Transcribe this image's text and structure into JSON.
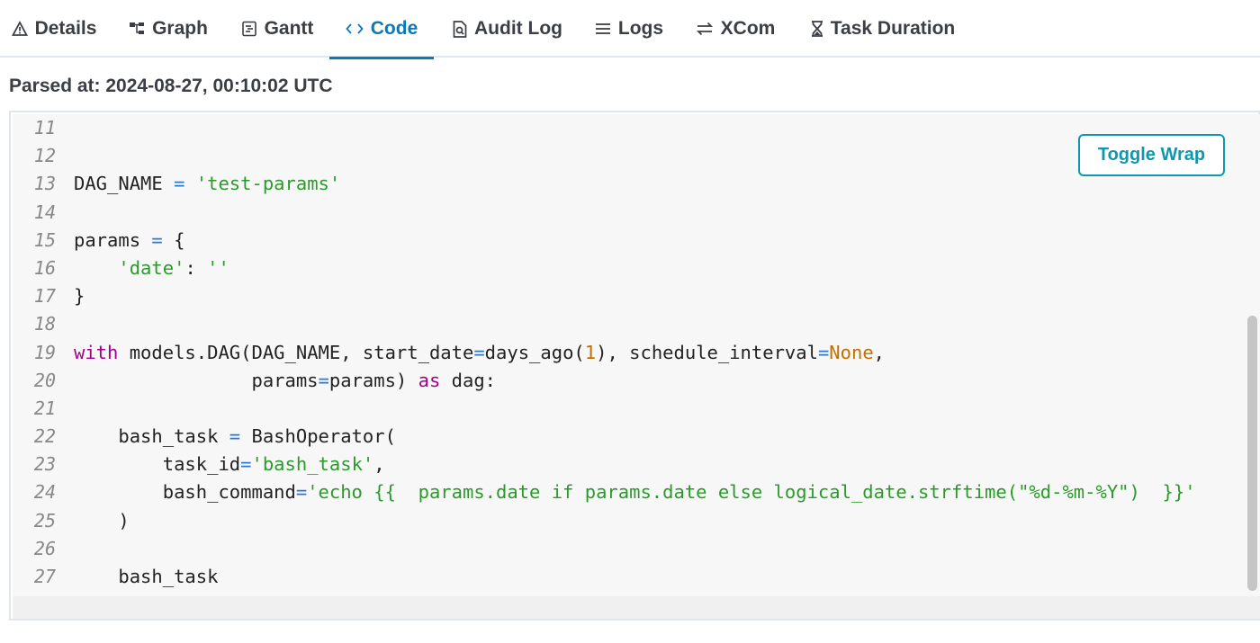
{
  "tabs": [
    {
      "icon": "warning-icon",
      "label": "Details"
    },
    {
      "icon": "graph-icon",
      "label": "Graph"
    },
    {
      "icon": "gantt-icon",
      "label": "Gantt"
    },
    {
      "icon": "code-icon",
      "label": "Code"
    },
    {
      "icon": "audit-log-icon",
      "label": "Audit Log"
    },
    {
      "icon": "logs-icon",
      "label": "Logs"
    },
    {
      "icon": "xcom-icon",
      "label": "XCom"
    },
    {
      "icon": "hourglass-icon",
      "label": "Task Duration"
    }
  ],
  "active_tab": "Code",
  "parsed_at": "Parsed at: 2024-08-27, 00:10:02 UTC",
  "toggle_wrap_label": "Toggle Wrap",
  "code_lines": [
    {
      "n": "11",
      "text": ""
    },
    {
      "n": "12",
      "text": ""
    },
    {
      "n": "13",
      "text": "DAG_NAME = 'test-params'"
    },
    {
      "n": "14",
      "text": ""
    },
    {
      "n": "15",
      "text": "params = {"
    },
    {
      "n": "16",
      "text": "    'date': ''"
    },
    {
      "n": "17",
      "text": "}"
    },
    {
      "n": "18",
      "text": ""
    },
    {
      "n": "19",
      "text": "with models.DAG(DAG_NAME, start_date=days_ago(1), schedule_interval=None,"
    },
    {
      "n": "20",
      "text": "                params=params) as dag:"
    },
    {
      "n": "21",
      "text": ""
    },
    {
      "n": "22",
      "text": "    bash_task = BashOperator("
    },
    {
      "n": "23",
      "text": "        task_id='bash_task',"
    },
    {
      "n": "24",
      "text": "        bash_command='echo {{  params.date if params.date else logical_date.strftime(\"%d-%m-%Y\")  }}'"
    },
    {
      "n": "25",
      "text": "    )"
    },
    {
      "n": "26",
      "text": ""
    },
    {
      "n": "27",
      "text": "    bash_task"
    }
  ],
  "colors": {
    "accent": "#0a79b8",
    "toggle": "#0f98ad",
    "keyword": "#a2008f",
    "string": "#2a9b2a",
    "number": "#c27000",
    "operator": "#2b77d1",
    "highlight_underline": "#e8111b"
  }
}
